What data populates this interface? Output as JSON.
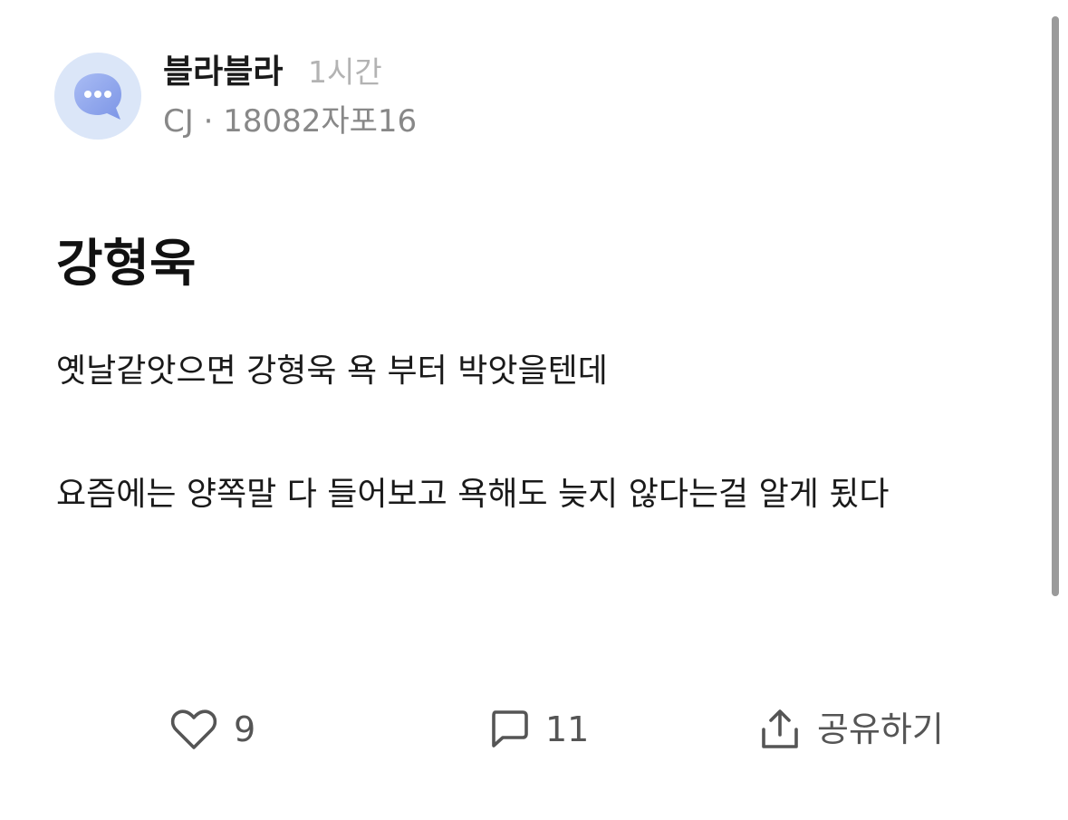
{
  "post": {
    "author": "블라블라",
    "time": "1시간",
    "meta": "CJ · 18082자포16",
    "title": "강형욱",
    "body": "옛날같앗으면 강형욱 욕 부터 박앗을텐데\n\n요즘에는 양쪽말 다 들어보고 욕해도 늦지 않다는걸 알게 됬다"
  },
  "actions": {
    "likes": "9",
    "comments": "11",
    "share_label": "공유하기"
  },
  "icons": {
    "avatar": "chat-bubble-icon",
    "like": "heart-icon",
    "comment": "comment-icon",
    "share": "share-icon"
  },
  "colors": {
    "avatar_bg": "#dbe6f8",
    "avatar_bubble": "#8ea6ee"
  }
}
